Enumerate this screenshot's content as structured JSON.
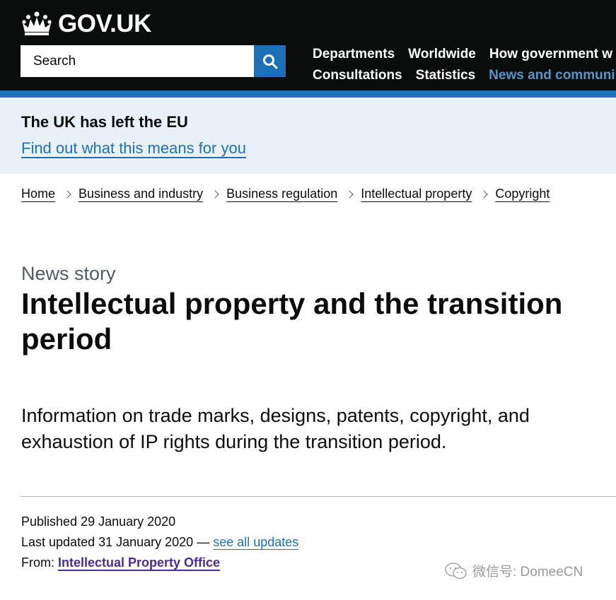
{
  "header": {
    "logo_text": "GOV.UK",
    "search_placeholder": "Search",
    "nav": {
      "row1": [
        "Departments",
        "Worldwide",
        "How government w"
      ],
      "row2": [
        "Consultations",
        "Statistics",
        "News and communi"
      ]
    }
  },
  "banner": {
    "title": "The UK has left the EU",
    "link": "Find out what this means for you"
  },
  "breadcrumbs": [
    "Home",
    "Business and industry",
    "Business regulation",
    "Intellectual property",
    "Copyright"
  ],
  "article": {
    "caption": "News story",
    "title": "Intellectual property and the transition period",
    "lead": "Information on trade marks, designs, patents, copyright, and exhaustion of IP rights during the transition period."
  },
  "meta": {
    "published": "Published 29 January 2020",
    "last_updated": "Last updated 31 January 2020 — ",
    "see_updates": "see all updates",
    "from_label": "From: ",
    "organisation": "Intellectual Property Office"
  },
  "watermark": "微信号: DomeeCN",
  "colors": {
    "header_bg": "#0b0c0c",
    "brand_blue": "#1d70b8",
    "banner_bg": "#e8f1f8",
    "org_purple": "#4c2c92"
  }
}
